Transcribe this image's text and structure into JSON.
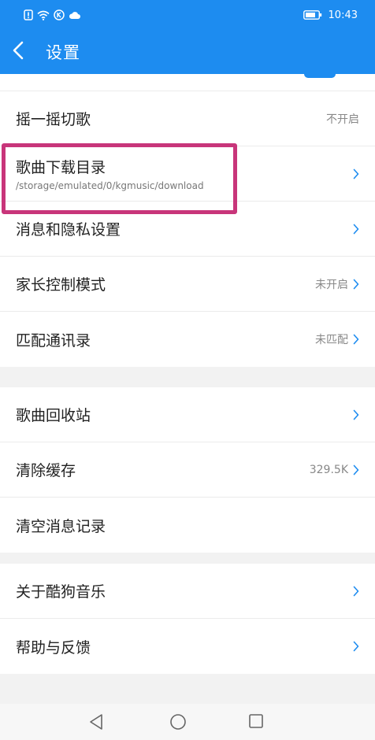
{
  "status_bar": {
    "time": "10:43"
  },
  "app_bar": {
    "title": "设置"
  },
  "groups": {
    "g1": [
      {
        "label": "摇一摇切歌",
        "value": "不开启"
      },
      {
        "label": "歌曲下载目录",
        "sub": "/storage/emulated/0/kgmusic/download"
      },
      {
        "label": "消息和隐私设置"
      },
      {
        "label": "家长控制模式",
        "value": "未开启"
      },
      {
        "label": "匹配通讯录",
        "value": "未匹配"
      }
    ],
    "g2": [
      {
        "label": "歌曲回收站"
      },
      {
        "label": "清除缓存",
        "value": "329.5K"
      },
      {
        "label": "清空消息记录"
      }
    ],
    "g3": [
      {
        "label": "关于酷狗音乐"
      },
      {
        "label": "帮助与反馈"
      }
    ]
  },
  "colors": {
    "primary": "#1d8cf0",
    "highlight": "#c8357a"
  }
}
